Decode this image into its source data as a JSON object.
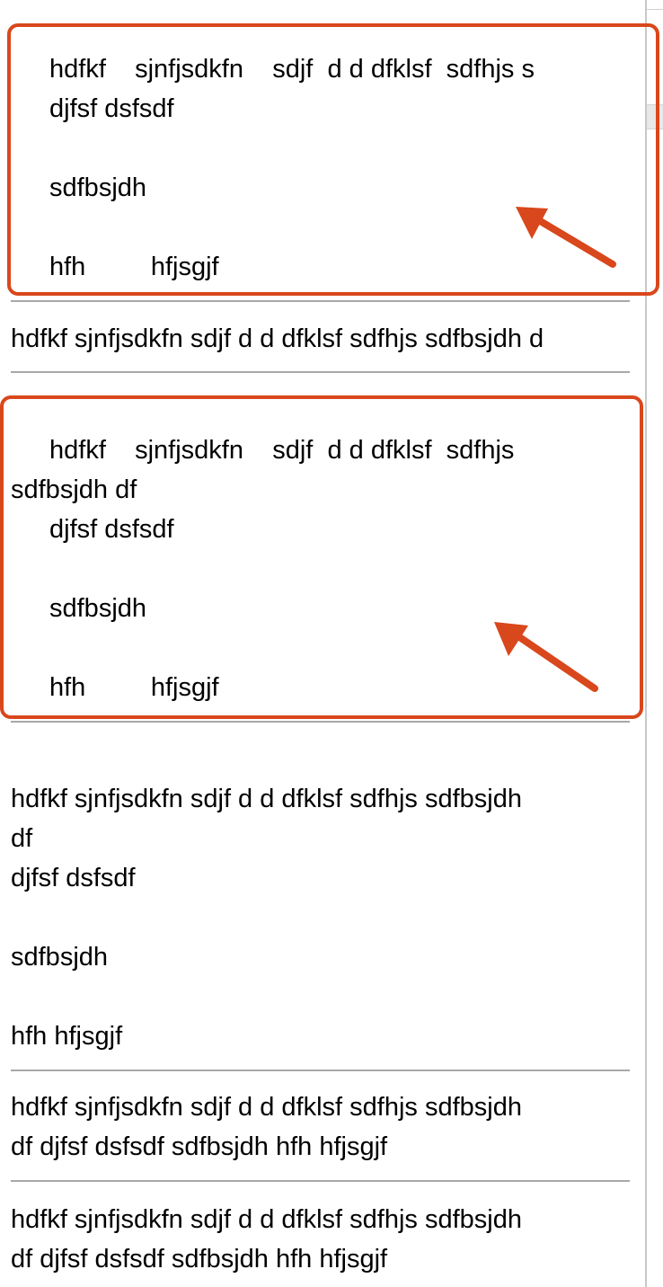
{
  "blocks": {
    "b1": {
      "line1": "hdfkf    sjnfjsdkfn    sdjf  d d dfklsf  sdfhjs s",
      "line2": "djfsf dsfsdf",
      "line3": "sdfbsjdh",
      "line4": "hfh         hfjsgjf"
    },
    "b2": {
      "line1": "hdfkf sjnfjsdkfn sdjf d d dfklsf sdfhjs sdfbsjdh d"
    },
    "b3": {
      "line1": "hdfkf    sjnfjsdkfn    sdjf  d d dfklsf  sdfhjs",
      "line2": "sdfbsjdh df",
      "line3": "djfsf dsfsdf",
      "line4": "sdfbsjdh",
      "line5": "hfh         hfjsgjf"
    },
    "b4": {
      "line1": "hdfkf sjnfjsdkfn sdjf d d dfklsf sdfhjs sdfbsjdh",
      "line2": "df",
      "line3": "djfsf dsfsdf",
      "line4": "sdfbsjdh",
      "line5": "hfh hfjsgjf"
    },
    "b5": {
      "line1": "hdfkf sjnfjsdkfn sdjf d d dfklsf sdfhjs sdfbsjdh",
      "line2": "df djfsf dsfsdf sdfbsjdh hfh hfjsgjf"
    },
    "b6": {
      "line1": "hdfkf sjnfjsdkfn sdjf d d dfklsf sdfhjs sdfbsjdh",
      "line2": "df djfsf dsfsdf sdfbsjdh hfh hfjsgjf"
    }
  },
  "colors": {
    "annotation": "#d9471c",
    "rule": "#a8a8a8",
    "text": "#000000",
    "background": "#ffffff"
  },
  "icons": {
    "annotation_marker": "arrow-icon"
  }
}
